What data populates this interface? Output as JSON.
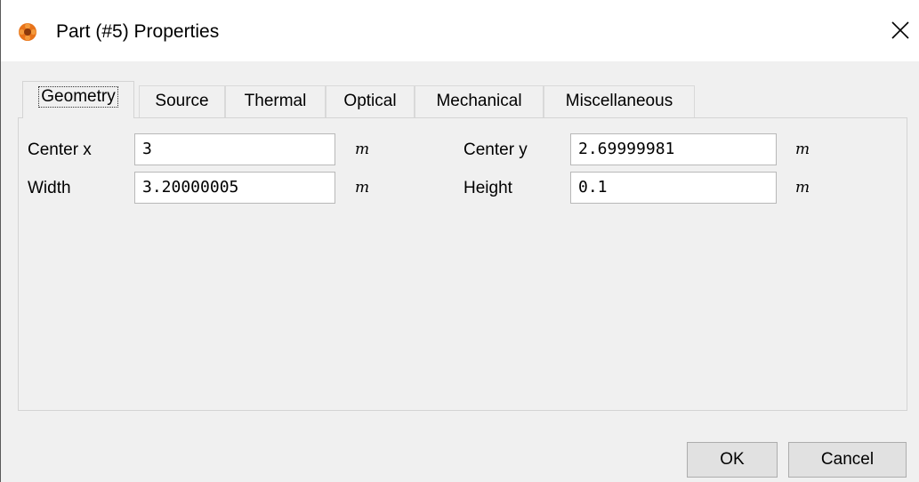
{
  "window": {
    "title": "Part (#5) Properties",
    "app_icon": "orange-flower-icon",
    "close_icon": "close-icon"
  },
  "tabs": [
    {
      "label": "Geometry",
      "active": true
    },
    {
      "label": "Source",
      "active": false
    },
    {
      "label": "Thermal",
      "active": false
    },
    {
      "label": "Optical",
      "active": false
    },
    {
      "label": "Mechanical",
      "active": false
    },
    {
      "label": "Miscellaneous",
      "active": false
    }
  ],
  "geometry": {
    "center_x": {
      "label": "Center x",
      "value": "3",
      "unit": "m"
    },
    "center_y": {
      "label": "Center y",
      "value": "2.69999981",
      "unit": "m"
    },
    "width": {
      "label": "Width",
      "value": "3.20000005",
      "unit": "m"
    },
    "height": {
      "label": "Height",
      "value": "0.1",
      "unit": "m"
    }
  },
  "buttons": {
    "ok": "OK",
    "cancel": "Cancel"
  },
  "colors": {
    "dialog_background": "#f0f0f0",
    "icon_orange": "#e8731a",
    "icon_center": "#8b3a0c"
  }
}
